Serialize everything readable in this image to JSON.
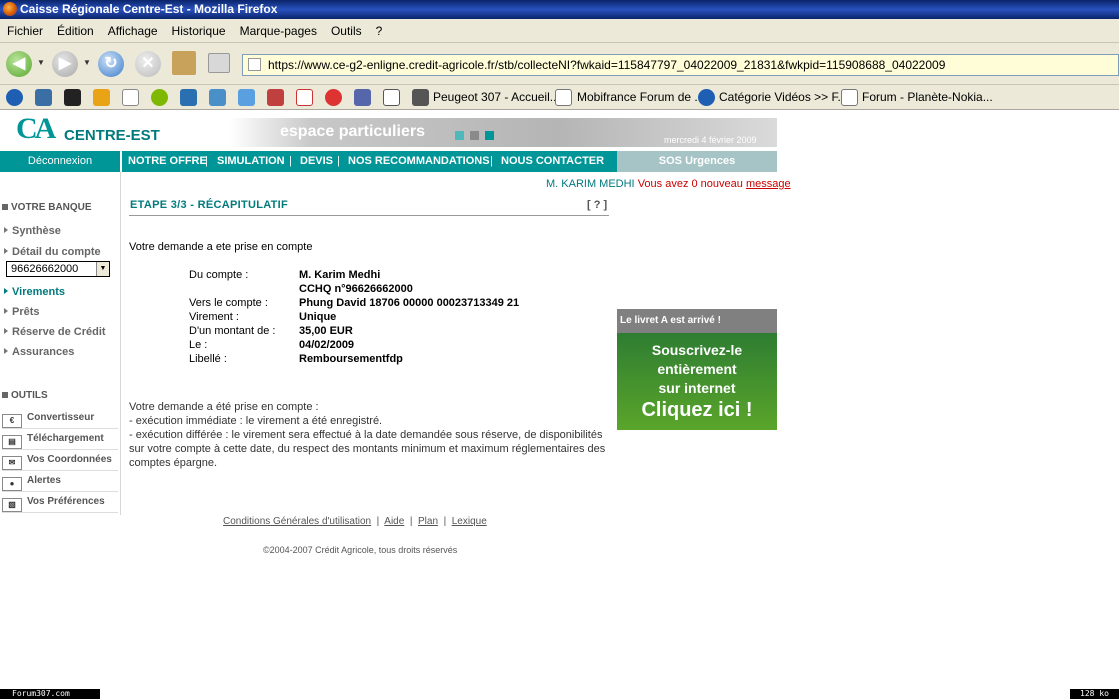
{
  "window": {
    "title": "Caisse Régionale Centre-Est - Mozilla Firefox"
  },
  "menu": [
    "Fichier",
    "Édition",
    "Affichage",
    "Historique",
    "Marque-pages",
    "Outils",
    "?"
  ],
  "address": {
    "url": "https://www.ce-g2-enligne.credit-agricole.fr/stb/collecteNI?fwkaid=115847797_04022009_21831&fwkpid=115908688_04022009"
  },
  "bookmarks": [
    "Peugeot 307 - Accueil...",
    "Mobifrance Forum de ...",
    "Catégorie Vidéos >> F...",
    "Forum - Planète-Nokia..."
  ],
  "site": {
    "logo_text": "CENTRE-EST",
    "banner_text": "espace particuliers",
    "date": "mercredi 4 février 2009",
    "logout": "Déconnexion",
    "nav": [
      "NOTRE OFFRE",
      "SIMULATION",
      "DEVIS",
      "NOS RECOMMANDATIONS",
      "NOUS CONTACTER"
    ],
    "sos": "SOS Urgences",
    "user_name": "M. KARIM MEDHI",
    "user_msg": "Vous avez 0 nouveau",
    "user_link": "message"
  },
  "sidebar": {
    "bank_heading": "VOTRE BANQUE",
    "items": [
      "Synthèse",
      "Détail du compte",
      "Virements",
      "Prêts",
      "Réserve de Crédit",
      "Assurances"
    ],
    "account_select": "96626662000",
    "tools_heading": "OUTILS",
    "tools": [
      "Convertisseur",
      "Téléchargement",
      "Vos Coordonnées",
      "Alertes",
      "Vos Préférences"
    ]
  },
  "main": {
    "step_title": "ETAPE 3/3 - RÉCAPITULATIF",
    "help": "[ ? ]",
    "intro": "Votre demande a ete prise en compte",
    "summary": [
      {
        "label": "Du compte :",
        "value": "M. Karim Medhi"
      },
      {
        "label": "",
        "value": "CCHQ n°96626662000"
      },
      {
        "label": "Vers le compte :",
        "value": "Phung David 18706 00000 00023713349 21"
      },
      {
        "label": "Virement :",
        "value": "Unique"
      },
      {
        "label": "D'un montant de :",
        "value": "35,00 EUR"
      },
      {
        "label": "Le :",
        "value": "04/02/2009"
      },
      {
        "label": "Libellé :",
        "value": "Remboursementfdp"
      }
    ],
    "notes": [
      "Votre demande a été prise en compte :",
      "- exécution immédiate : le virement a été enregistré.",
      "- exécution différée : le virement sera effectué à la date demandée sous réserve, de disponibilités",
      "sur votre compte à cette date, du respect des montants minimum et maximum réglementaires des",
      "comptes épargne."
    ]
  },
  "ad": {
    "header": "Le livret A est arrivé !",
    "line1": "Souscrivez-le",
    "line2": "entièrement",
    "line3": "sur internet",
    "cta": "Cliquez ici !"
  },
  "footer": {
    "links": [
      "Conditions Générales d'utilisation",
      "Aide",
      "Plan",
      "Lexique"
    ],
    "copyright": "©2004-2007 Crédit Agricole, tous droits réservés"
  },
  "status": {
    "left": "Forum307.com",
    "right": "128 ko"
  },
  "colors": {
    "brand": "#009597",
    "accent": "#007a7c"
  }
}
